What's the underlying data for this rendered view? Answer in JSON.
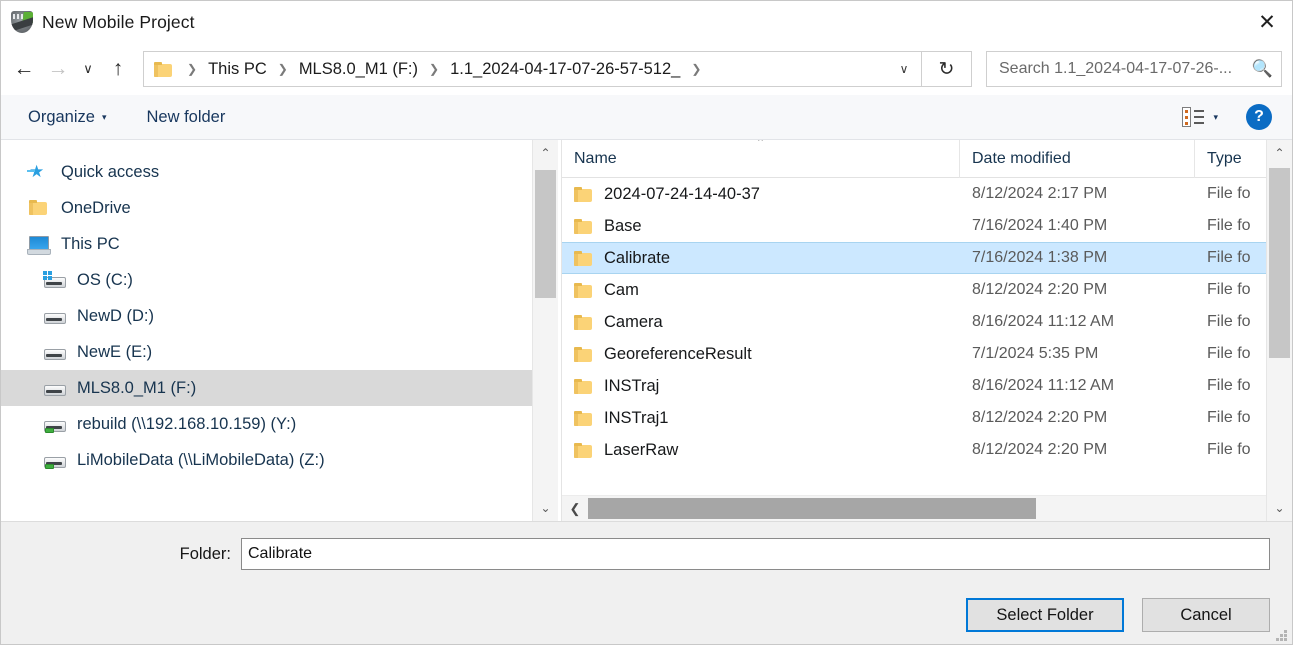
{
  "window": {
    "title": "New Mobile Project",
    "app_icon": "app-logo-icon",
    "close_label": "✕"
  },
  "nav": {
    "back": "←",
    "forward": "→",
    "recent": "∨",
    "up": "↑",
    "refresh": "↻",
    "dropdown": "∨",
    "breadcrumbs": [
      {
        "label": "This PC"
      },
      {
        "label": "MLS8.0_M1 (F:)"
      },
      {
        "label": "1.1_2024-04-17-07-26-57-512_"
      }
    ],
    "separator": "❯"
  },
  "search": {
    "placeholder": "Search 1.1_2024-04-17-07-26-...",
    "value": "",
    "icon": "search-icon"
  },
  "commandbar": {
    "organize_label": "Organize",
    "organize_caret": "▾",
    "new_folder_label": "New folder",
    "view_caret": "▾",
    "help_label": "?"
  },
  "sidebar": {
    "items": [
      {
        "label": "Quick access",
        "icon": "star-icon",
        "indent": false,
        "selected": false
      },
      {
        "label": "OneDrive",
        "icon": "folder-icon",
        "indent": false,
        "selected": false
      },
      {
        "label": "This PC",
        "icon": "pc-icon",
        "indent": false,
        "selected": false
      },
      {
        "label": "OS (C:)",
        "icon": "drive-os-icon",
        "indent": true,
        "selected": false
      },
      {
        "label": "NewD (D:)",
        "icon": "drive-icon",
        "indent": true,
        "selected": false
      },
      {
        "label": "NewE (E:)",
        "icon": "drive-icon",
        "indent": true,
        "selected": false
      },
      {
        "label": "MLS8.0_M1 (F:)",
        "icon": "drive-icon",
        "indent": true,
        "selected": true
      },
      {
        "label": "rebuild (\\\\192.168.10.159) (Y:)",
        "icon": "network-drive-icon",
        "indent": true,
        "selected": false
      },
      {
        "label": "LiMobileData (\\\\LiMobileData) (Z:)",
        "icon": "network-drive-icon",
        "indent": true,
        "selected": false
      }
    ],
    "scroll_up": "⌃",
    "scroll_down": "⌄"
  },
  "filelist": {
    "columns": {
      "name": "Name",
      "date_modified": "Date modified",
      "type": "Type"
    },
    "sort_indicator": "⌃",
    "rows": [
      {
        "name": "2024-07-24-14-40-37",
        "date": "8/12/2024 2:17 PM",
        "type": "File fo",
        "selected": false
      },
      {
        "name": "Base",
        "date": "7/16/2024 1:40 PM",
        "type": "File fo",
        "selected": false
      },
      {
        "name": "Calibrate",
        "date": "7/16/2024 1:38 PM",
        "type": "File fo",
        "selected": true
      },
      {
        "name": "Cam",
        "date": "8/12/2024 2:20 PM",
        "type": "File fo",
        "selected": false
      },
      {
        "name": "Camera",
        "date": "8/16/2024 11:12 AM",
        "type": "File fo",
        "selected": false
      },
      {
        "name": "GeoreferenceResult",
        "date": "7/1/2024 5:35 PM",
        "type": "File fo",
        "selected": false
      },
      {
        "name": "INSTraj",
        "date": "8/16/2024 11:12 AM",
        "type": "File fo",
        "selected": false
      },
      {
        "name": "INSTraj1",
        "date": "8/12/2024 2:20 PM",
        "type": "File fo",
        "selected": false
      },
      {
        "name": "LaserRaw",
        "date": "8/12/2024 2:20 PM",
        "type": "File fo",
        "selected": false
      }
    ],
    "scroll_up": "⌃",
    "scroll_down": "⌄",
    "scroll_left": "❮",
    "scroll_right": "❯"
  },
  "footer": {
    "folder_label": "Folder:",
    "folder_value": "Calibrate",
    "folder_placeholder": "",
    "select_label": "Select Folder",
    "cancel_label": "Cancel"
  }
}
